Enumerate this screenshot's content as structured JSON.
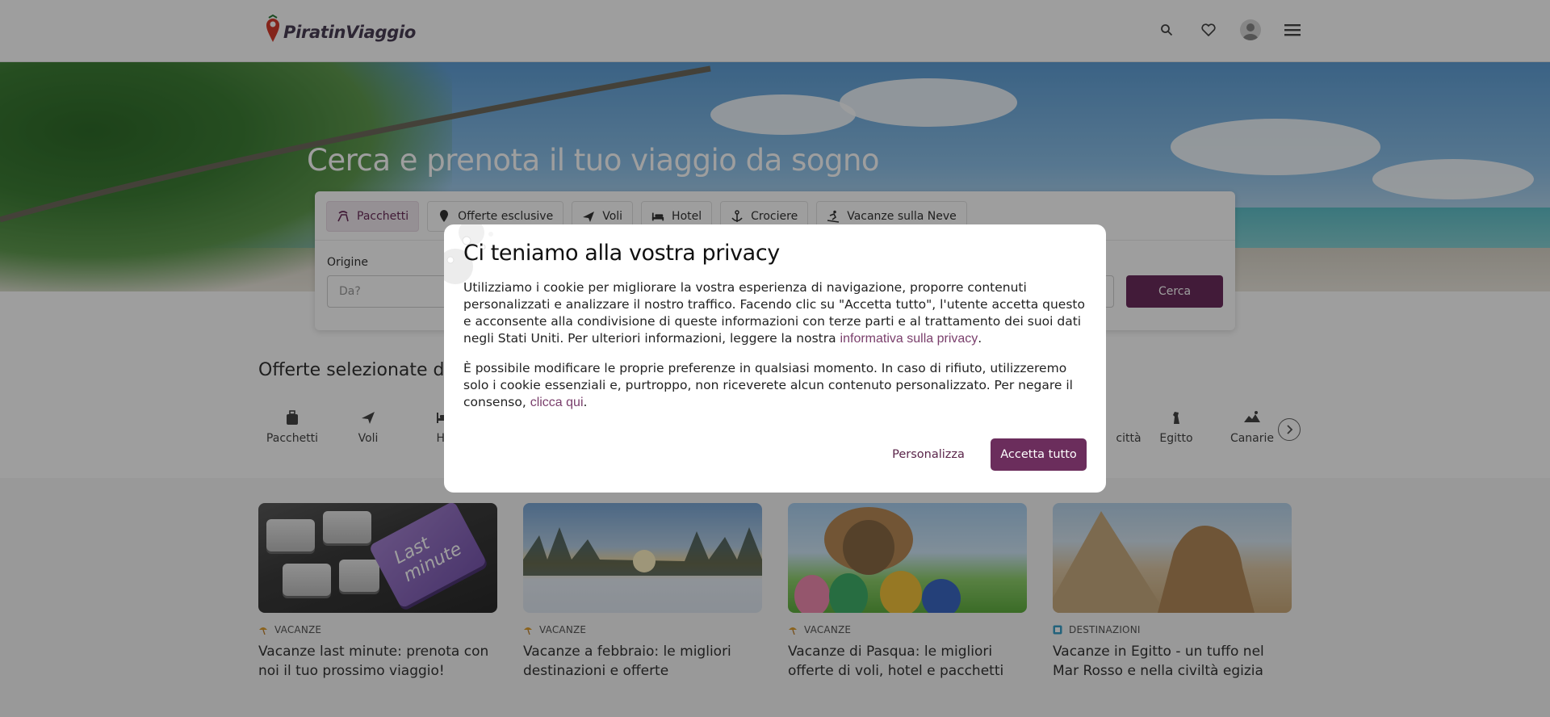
{
  "header": {
    "logo_text": "PiratinViaggio",
    "icons": [
      "search-icon",
      "heart-icon",
      "user-avatar",
      "menu-icon"
    ]
  },
  "hero": {
    "title": "Cerca e prenota il tuo viaggio da sogno"
  },
  "search": {
    "tabs": [
      {
        "label": "Pacchetti",
        "icon": "beach-chair-icon",
        "active": true
      },
      {
        "label": "Offerte esclusive",
        "icon": "tag-icon",
        "active": false
      },
      {
        "label": "Voli",
        "icon": "plane-icon",
        "active": false
      },
      {
        "label": "Hotel",
        "icon": "bed-icon",
        "active": false
      },
      {
        "label": "Crociere",
        "icon": "anchor-icon",
        "active": false
      },
      {
        "label": "Vacanze sulla Neve",
        "icon": "skier-icon",
        "active": false
      }
    ],
    "origin_label": "Origine",
    "origin_placeholder": "Da?",
    "button_label": "Cerca"
  },
  "offers": {
    "section_title": "Offerte selezionate dal n",
    "categories": [
      {
        "label": "Pacchetti",
        "icon": "suitcase-icon"
      },
      {
        "label": "Voli",
        "icon": "plane-icon"
      },
      {
        "label": "Ho",
        "icon": "bed-icon"
      },
      {
        "label": "città",
        "icon": "city-icon"
      },
      {
        "label": "Egitto",
        "icon": "egypt-icon"
      },
      {
        "label": "Canarie",
        "icon": "island-icon"
      }
    ]
  },
  "cards": [
    {
      "tag": "VACANZE",
      "tag_icon": "beach-icon",
      "title": "Vacanze last minute: prenota con noi il tuo prossimo viaggio!",
      "image_text": "Last minute"
    },
    {
      "tag": "VACANZE",
      "tag_icon": "beach-icon",
      "title": "Vacanze a febbraio: le migliori destinazioni e offerte"
    },
    {
      "tag": "VACANZE",
      "tag_icon": "beach-icon",
      "title": "Vacanze di Pasqua: le migliori offerte di voli, hotel e pacchetti"
    },
    {
      "tag": "DESTINAZIONI",
      "tag_icon": "map-icon",
      "title": "Vacanze in Egitto - un tuffo nel Mar Rosso e nella civiltà egizia"
    }
  ],
  "modal": {
    "title": "Ci teniamo alla vostra privacy",
    "para1_text": "Utilizziamo i cookie per migliorare la vostra esperienza di navigazione, proporre contenuti personalizzati e analizzare il nostro traffico. Facendo clic su \"Accetta tutto\", l'utente accetta questo e acconsente alla condivisione di queste informazioni con terze parti e al trattamento dei suoi dati negli Stati Uniti. Per ulteriori informazioni, leggere la nostra ",
    "para1_link": "informativa sulla privacy",
    "para1_end": ".",
    "para2_text": "È possibile modificare le proprie preferenze in qualsiasi momento. In caso di rifiuto, utilizzeremo solo i cookie essenziali e, purtroppo, non riceverete alcun contenuto personalizzato. Per negare il consenso, ",
    "para2_link": "clicca qui",
    "para2_end": ".",
    "btn_customize": "Personalizza",
    "btn_accept": "Accetta tutto"
  },
  "colors": {
    "brand": "#6b2d5c",
    "link": "#7a3f6c",
    "overlay": "rgba(0,0,0,0.38)"
  }
}
